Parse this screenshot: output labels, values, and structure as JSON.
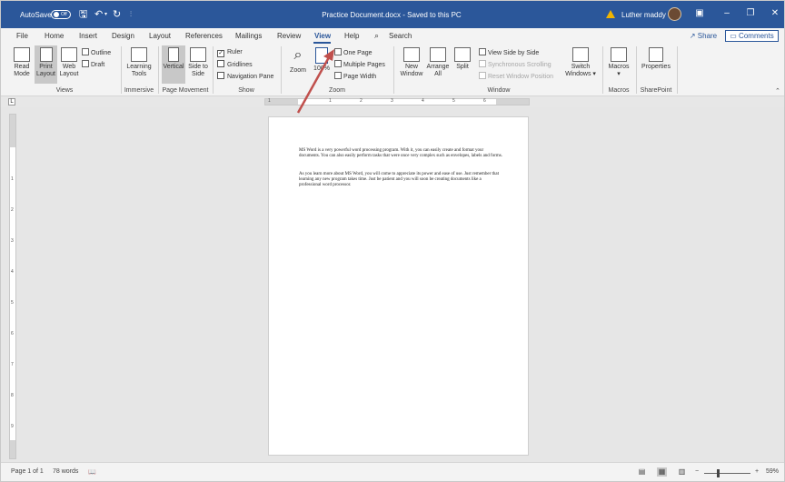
{
  "titlebar": {
    "autosave_label": "AutoSave",
    "autosave_state": "Off",
    "doc_title": "Practice Document.docx - Saved to this PC",
    "user_name": "Luther maddy",
    "brand_color": "#2b579a",
    "warning_color": "#f0b400"
  },
  "tabs": [
    "File",
    "Home",
    "Insert",
    "Design",
    "Layout",
    "References",
    "Mailings",
    "Review",
    "View",
    "Help"
  ],
  "active_tab": "View",
  "search_label": "Search",
  "share_label": "Share",
  "comments_label": "Comments",
  "ribbon": {
    "views": {
      "read_mode": "Read Mode",
      "print_layout": "Print Layout",
      "web_layout": "Web Layout",
      "outline": "Outline",
      "draft": "Draft",
      "group_label": "Views"
    },
    "immersive": {
      "learning_tools": "Learning Tools",
      "group_label": "Immersive"
    },
    "page_movement": {
      "vertical": "Vertical",
      "side_to_side": "Side to Side",
      "group_label": "Page Movement"
    },
    "show": {
      "ruler": "Ruler",
      "ruler_checked": true,
      "gridlines": "Gridlines",
      "gridlines_checked": false,
      "navigation_pane": "Navigation Pane",
      "navigation_pane_checked": false,
      "group_label": "Show"
    },
    "zoom": {
      "zoom": "Zoom",
      "hundred": "100%",
      "one_page": "One Page",
      "multiple_pages": "Multiple Pages",
      "page_width": "Page Width",
      "group_label": "Zoom"
    },
    "window": {
      "new_window": "New Window",
      "arrange_all": "Arrange All",
      "split": "Split",
      "view_side_by_side": "View Side by Side",
      "synchronous_scrolling": "Synchronous Scrolling",
      "reset_window_position": "Reset Window Position",
      "switch_windows": "Switch Windows",
      "group_label": "Window"
    },
    "macros": {
      "macros": "Macros",
      "group_label": "Macros"
    },
    "sharepoint": {
      "properties": "Properties",
      "group_label": "SharePoint"
    }
  },
  "document": {
    "paragraphs": [
      "MS Word is a very powerful word processing program.  With it, you can easily create and format your documents.  You can also easily perform tasks that were once very complex such as envelopes, labels and forms.",
      "As you learn more about MS Word, you will come to appreciate its power and ease of use.  Just remember that learning any new program takes time.  Just be patient and you will soon be creating documents like a professional word processor."
    ]
  },
  "ruler": {
    "h_numbers": [
      "1",
      "1",
      "2",
      "3",
      "4",
      "5",
      "6"
    ],
    "v_numbers": [
      "1",
      "2",
      "3",
      "4",
      "5",
      "6",
      "7",
      "8",
      "9"
    ]
  },
  "statusbar": {
    "page_info": "Page 1 of 1",
    "word_count": "78 words",
    "zoom_level": "59%",
    "zoom_minus": "−",
    "zoom_plus": "+"
  },
  "annotation": {
    "arrow_color": "#c0504d",
    "points_to": "One Page"
  }
}
